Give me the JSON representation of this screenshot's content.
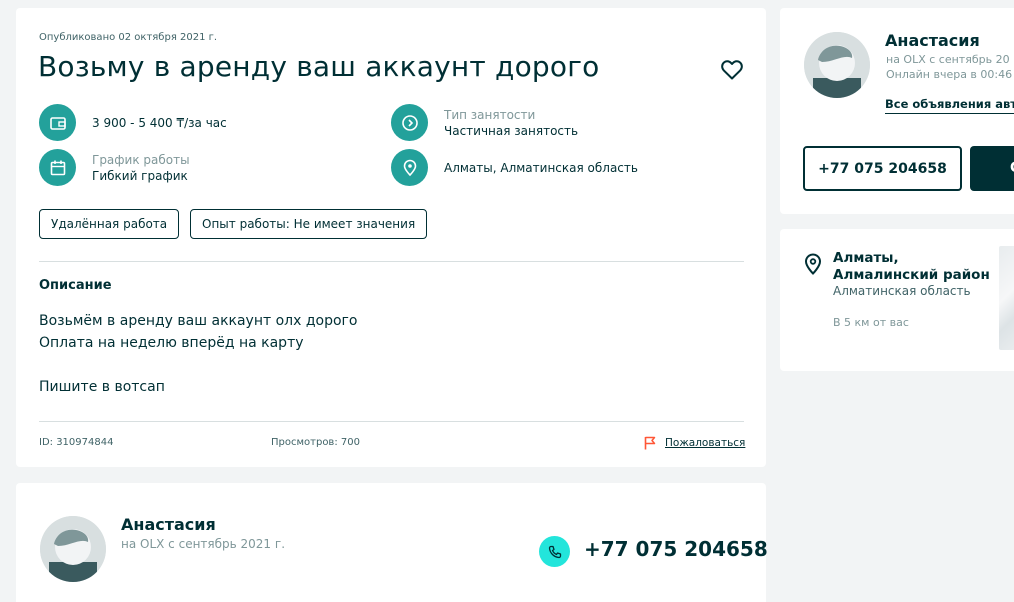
{
  "ad": {
    "published": "Опубликовано 02 октября 2021 г.",
    "title": "Возьму в аренду ваш аккаунт дорого",
    "params": {
      "salary": {
        "icon": "wallet-icon",
        "value": "3 900 - 5 400 ₸/за час"
      },
      "employment": {
        "icon": "clock-icon",
        "label": "Тип занятости",
        "value": "Частичная занятость"
      },
      "schedule": {
        "icon": "calendar-icon",
        "label": "График работы",
        "value": "Гибкий график"
      },
      "location": {
        "icon": "pin-icon",
        "value": "Алматы, Алматинская область"
      }
    },
    "tags": [
      "Удалённая работа",
      "Опыт работы: Не имеет значения"
    ],
    "description_heading": "Описание",
    "description": "Возьмём в аренду ваш аккаунт олх дорого\nОплата на неделю вперёд на карту\n\nПишите в вотсап",
    "id_text": "ID: 310974844",
    "views_text": "Просмотров: 700",
    "report_label": "Пожаловаться"
  },
  "seller": {
    "name": "Анастасия",
    "since": "на OLX с сентябрь 2021 г.",
    "phone": "+77 075 204658"
  },
  "sidebar": {
    "name": "Анастасия",
    "since": "на OLX с сентябрь 20",
    "online": "Онлайн вчера в 00:46",
    "all_ads_link": "Все объявления авто",
    "phone_button": "+77 075 204658",
    "message_button": "С"
  },
  "location_card": {
    "city": "Алматы,\nАлмалинский район",
    "region": "Алматинская область",
    "distance": "В 5 км от вас"
  },
  "colors": {
    "accent": "#23a19b",
    "accent_light": "#23e5db",
    "text_dark": "#002f34",
    "background": "#f2f4f5",
    "report_flag": "#ff5636"
  }
}
